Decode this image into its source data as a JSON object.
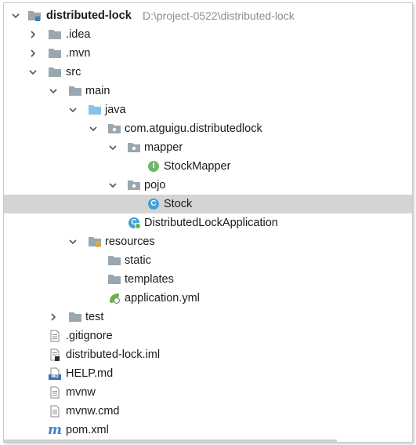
{
  "tree": {
    "root": {
      "label": "distributed-lock",
      "path": "D:\\project-0522\\distributed-lock"
    },
    "idea": {
      "label": ".idea"
    },
    "mvn": {
      "label": ".mvn"
    },
    "src": {
      "label": "src"
    },
    "main": {
      "label": "main"
    },
    "java": {
      "label": "java"
    },
    "package": {
      "label": "com.atguigu.distributedlock"
    },
    "mapper": {
      "label": "mapper"
    },
    "stock_mapper": {
      "label": "StockMapper",
      "icon_letter": "I"
    },
    "pojo": {
      "label": "pojo"
    },
    "stock": {
      "label": "Stock",
      "icon_letter": "C"
    },
    "application_class": {
      "label": "DistributedLockApplication",
      "icon_letter": "C"
    },
    "resources": {
      "label": "resources"
    },
    "static": {
      "label": "static"
    },
    "templates": {
      "label": "templates"
    },
    "application_yml": {
      "label": "application.yml"
    },
    "test": {
      "label": "test"
    },
    "gitignore": {
      "label": ".gitignore"
    },
    "iml": {
      "label": "distributed-lock.iml"
    },
    "help": {
      "label": "HELP.md",
      "badge": "MD"
    },
    "mvnw": {
      "label": "mvnw"
    },
    "mvnw_cmd": {
      "label": "mvnw.cmd"
    },
    "pom": {
      "label": "pom.xml",
      "badge": "m"
    }
  },
  "colors": {
    "selected_row": "#d4d4d4",
    "folder": "#9aa7b0",
    "source_folder": "#87c3e8",
    "interface_icon": "#6fb86b",
    "class_icon": "#3fa0d8",
    "spring_green": "#6db33f"
  }
}
